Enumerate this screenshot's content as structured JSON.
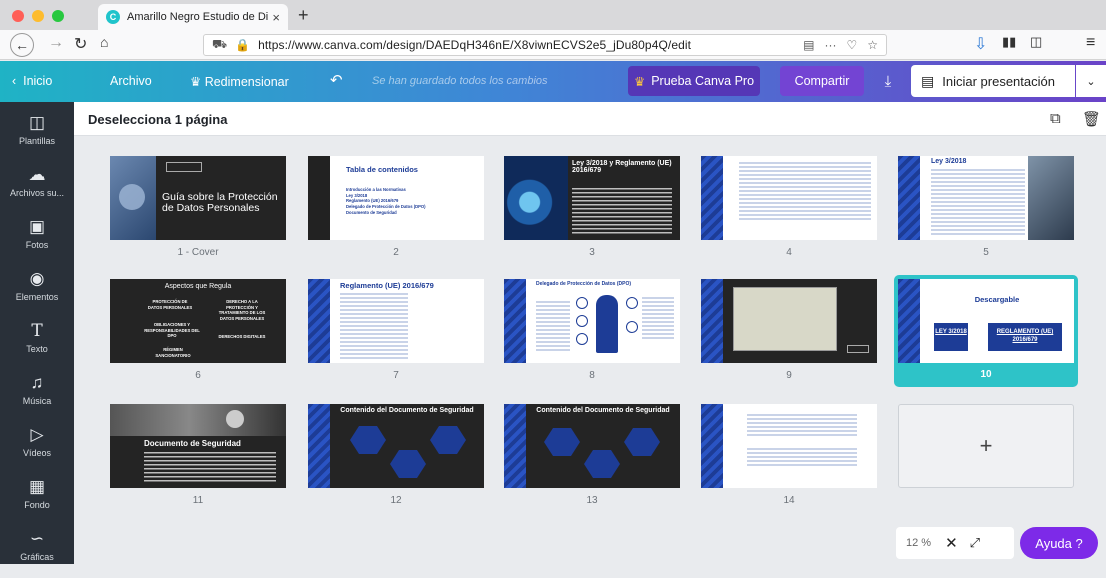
{
  "browser": {
    "tab_title": "Amarillo Negro Estudio de Dise",
    "tab_close": "×",
    "new_tab": "+",
    "url": "https://www.canva.com/design/DAEDqH346nE/X8viwnECVS2e5_jDu80p4Q/edit",
    "menu_dots": "···",
    "colors": {
      "close": "#ff5f57",
      "minimize": "#febc2e",
      "maximize": "#28c840"
    }
  },
  "canva": {
    "inicio": "Inicio",
    "archivo": "Archivo",
    "redimensionar": "Redimensionar",
    "saved": "Se han guardado todos los cambios",
    "prueba": "Prueba Canva Pro",
    "compartir": "Compartir",
    "presentar": "Iniciar presentación"
  },
  "sidebar": [
    {
      "label": "Plantillas",
      "icon": "template-icon"
    },
    {
      "label": "Archivos su...",
      "icon": "cloud-upload-icon"
    },
    {
      "label": "Fotos",
      "icon": "photo-icon"
    },
    {
      "label": "Elementos",
      "icon": "shapes-icon"
    },
    {
      "label": "Texto",
      "icon": "text-icon"
    },
    {
      "label": "Música",
      "icon": "music-icon"
    },
    {
      "label": "Vídeos",
      "icon": "video-icon"
    },
    {
      "label": "Fondo",
      "icon": "background-icon"
    },
    {
      "label": "Gráficas",
      "icon": "chart-icon"
    }
  ],
  "toolbar": {
    "deselect": "Deselecciona 1 página"
  },
  "slides": [
    {
      "label": "1 - Cover",
      "title": "Guía sobre la Protección de Datos Personales"
    },
    {
      "label": "2",
      "title": "Tabla de contenidos",
      "items": [
        "Introducción a las Normativas",
        "Ley 3/2018",
        "Reglamento (UE) 2016/679",
        "Delegado de Protección de Datos (DPO)",
        "Documento de Seguridad"
      ]
    },
    {
      "label": "3",
      "title": "Ley 3/2018 y Reglamento (UE) 2016/679"
    },
    {
      "label": "4"
    },
    {
      "label": "5",
      "title": "Ley 3/2018"
    },
    {
      "label": "6",
      "title": "Aspectos que Regula",
      "items": [
        "PROTECCIÓN DE DATOS PERSONALES",
        "DERECHO A LA PROTECCIÓN Y TRATAMIENTO DE LOS DATOS PERSONALES",
        "OBLIGACIONES Y RESPONSABILIDADES DEL DPO",
        "DERECHOS DIGITALES",
        "RÉGIMEN SANCIONATORIO"
      ]
    },
    {
      "label": "7",
      "title": "Reglamento (UE) 2016/679"
    },
    {
      "label": "8",
      "title": "Delegado de Protección de Datos (DPO)"
    },
    {
      "label": "9"
    },
    {
      "label": "10",
      "title": "Descargable",
      "links": [
        "LEY 3/2018",
        "REGLAMENTO (UE) 2016/679"
      ]
    },
    {
      "label": "11",
      "title": "Documento de Seguridad"
    },
    {
      "label": "12",
      "title": "Contenido del Documento de Seguridad"
    },
    {
      "label": "13",
      "title": "Contenido del Documento de Seguridad"
    },
    {
      "label": "14"
    }
  ],
  "add_page": "+",
  "zoom": {
    "value": "12 %"
  },
  "help": "Ayuda ?"
}
